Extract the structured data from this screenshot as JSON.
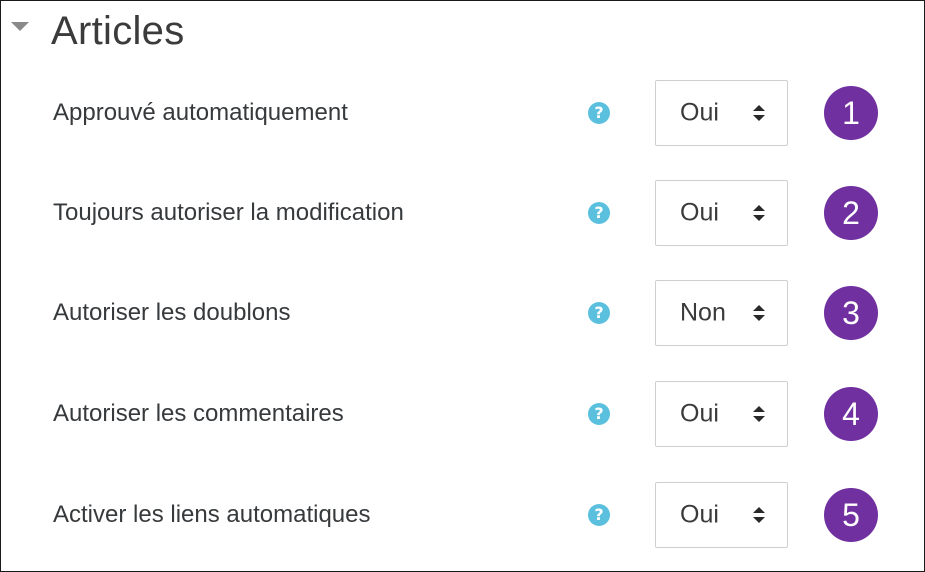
{
  "section": {
    "title": "Articles",
    "caret_icon": "caret-down-icon"
  },
  "rows": [
    {
      "label": "Approuvé automatiquement",
      "value": "Oui",
      "badge": "1",
      "help": "?"
    },
    {
      "label": "Toujours autoriser la modification",
      "value": "Oui",
      "badge": "2",
      "help": "?"
    },
    {
      "label": "Autoriser les doublons",
      "value": "Non",
      "badge": "3",
      "help": "?"
    },
    {
      "label": "Autoriser les commentaires",
      "value": "Oui",
      "badge": "4",
      "help": "?"
    },
    {
      "label": "Activer les liens automatiques",
      "value": "Oui",
      "badge": "5",
      "help": "?"
    }
  ],
  "colors": {
    "help_icon": "#5bc0de",
    "badge": "#7030a0",
    "text": "#373a3c"
  }
}
